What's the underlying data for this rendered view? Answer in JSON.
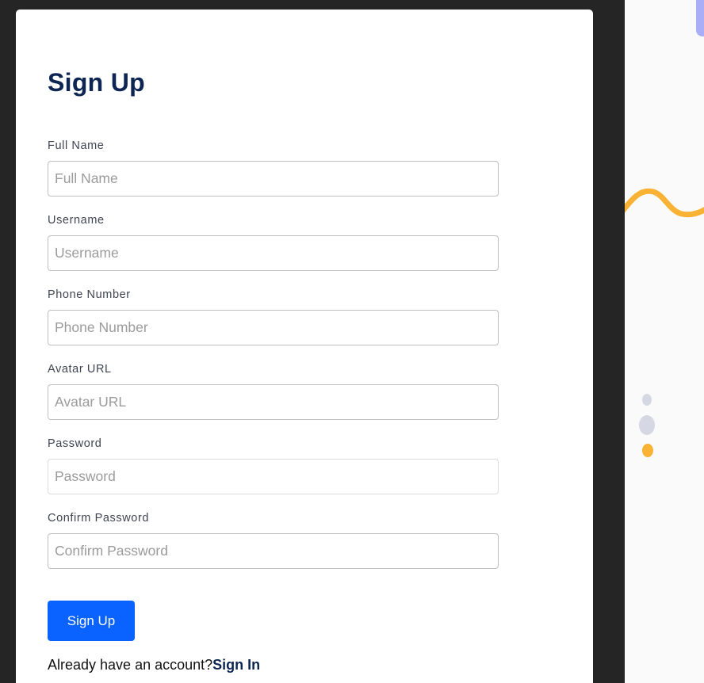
{
  "form": {
    "title": "Sign Up",
    "fields": [
      {
        "label": "Full Name",
        "placeholder": "Full Name",
        "value": ""
      },
      {
        "label": "Username",
        "placeholder": "Username",
        "value": ""
      },
      {
        "label": "Phone Number",
        "placeholder": "Phone Number",
        "value": ""
      },
      {
        "label": "Avatar URL",
        "placeholder": "Avatar URL",
        "value": ""
      },
      {
        "label": "Password",
        "placeholder": "Password",
        "value": ""
      },
      {
        "label": "Confirm Password",
        "placeholder": "Confirm Password",
        "value": ""
      }
    ],
    "submit_label": "Sign Up",
    "signin_prompt": "Already have an account?",
    "signin_link": "Sign In"
  },
  "colors": {
    "backdrop": "#252525",
    "card": "#ffffff",
    "title": "#0d2552",
    "primary_button": "#0a63ff",
    "accent_yellow": "#f9b233",
    "accent_blue": "#a9aef7",
    "dot_gray": "#d5d8e2"
  }
}
